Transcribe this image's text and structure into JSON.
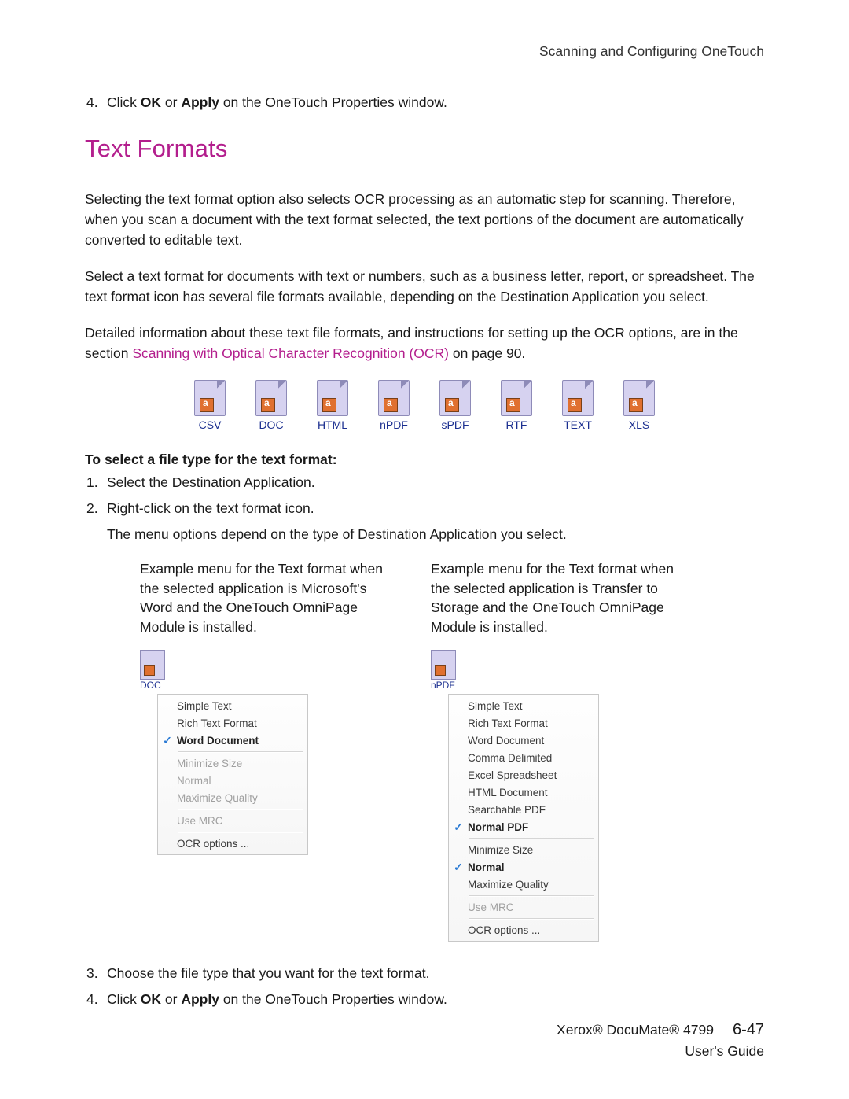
{
  "header": {
    "breadcrumb": "Scanning and Configuring OneTouch"
  },
  "intro_step": {
    "num": "4.",
    "prefix": "Click ",
    "ok": "OK",
    "mid": " or ",
    "apply": "Apply",
    "suffix": " on the OneTouch Properties window."
  },
  "h2": "Text Formats",
  "p1": "Selecting the text format option also selects OCR processing as an automatic step for scanning. Therefore, when you scan a document with the text format selected, the text portions of the document are automatically converted to editable text.",
  "p2": "Select a text format for documents with text or numbers, such as a business letter, report, or spreadsheet. The text format icon has several file formats available, depending on the Destination Application you select.",
  "p3_prefix": "Detailed information about these text file formats, and instructions for setting up the OCR options, are in the section ",
  "p3_link": "Scanning with Optical Character Recognition (OCR)",
  "p3_suffix": " on page 90.",
  "formats": [
    "CSV",
    "DOC",
    "HTML",
    "nPDF",
    "sPDF",
    "RTF",
    "TEXT",
    "XLS"
  ],
  "sel_heading": "To select a file type for the text format:",
  "steps_a": [
    {
      "num": "1.",
      "text": "Select the Destination Application."
    },
    {
      "num": "2.",
      "text": "Right-click on the text format icon."
    }
  ],
  "note_a": "The menu options depend on the type of Destination Application you select.",
  "left_caption": "Example menu for the Text format when the selected application is Microsoft's Word and the OneTouch OmniPage Module is installed.",
  "right_caption": "Example menu for the Text format when the selected application is Transfer to Storage and the OneTouch OmniPage Module is installed.",
  "left_icon_label": "DOC",
  "right_icon_label": "nPDF",
  "menu_left": {
    "g1": [
      {
        "label": "Simple Text",
        "checked": false,
        "bold": false
      },
      {
        "label": "Rich Text Format",
        "checked": false,
        "bold": false
      },
      {
        "label": "Word Document",
        "checked": true,
        "bold": true
      }
    ],
    "g2": [
      {
        "label": "Minimize Size",
        "disabled": true
      },
      {
        "label": "Normal",
        "disabled": true
      },
      {
        "label": "Maximize Quality",
        "disabled": true
      }
    ],
    "g3": [
      {
        "label": "Use MRC",
        "disabled": true
      }
    ],
    "g4": [
      {
        "label": "OCR options ..."
      }
    ]
  },
  "menu_right": {
    "g1": [
      {
        "label": "Simple Text"
      },
      {
        "label": "Rich Text Format"
      },
      {
        "label": "Word Document"
      },
      {
        "label": "Comma Delimited"
      },
      {
        "label": "Excel Spreadsheet"
      },
      {
        "label": "HTML Document"
      },
      {
        "label": "Searchable PDF"
      },
      {
        "label": "Normal PDF",
        "checked": true,
        "bold": true
      }
    ],
    "g2": [
      {
        "label": "Minimize Size"
      },
      {
        "label": "Normal",
        "checked": true,
        "bold": true
      },
      {
        "label": "Maximize Quality"
      }
    ],
    "g3": [
      {
        "label": "Use MRC",
        "disabled": true
      }
    ],
    "g4": [
      {
        "label": "OCR options ..."
      }
    ]
  },
  "steps_b": [
    {
      "num": "3.",
      "text": "Choose the file type that you want for the text format."
    },
    {
      "num": "4.",
      "prefix": "Click ",
      "ok": "OK",
      "mid": " or ",
      "apply": "Apply",
      "suffix": " on the OneTouch Properties window."
    }
  ],
  "footer": {
    "product": "Xerox® DocuMate® 4799",
    "page": "6-47",
    "sub": "User's Guide"
  }
}
